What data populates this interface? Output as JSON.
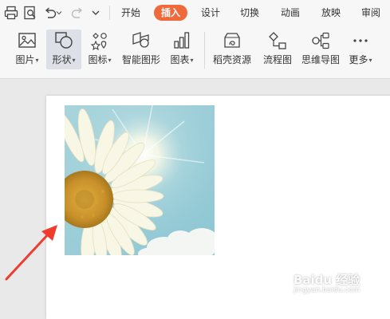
{
  "tabs": [
    {
      "label": "开始",
      "active": false
    },
    {
      "label": "插入",
      "active": true
    },
    {
      "label": "设计",
      "active": false
    },
    {
      "label": "切换",
      "active": false
    },
    {
      "label": "动画",
      "active": false
    },
    {
      "label": "放映",
      "active": false
    },
    {
      "label": "审阅",
      "active": false
    }
  ],
  "ribbon": [
    {
      "label": "图片",
      "has_dropdown": true,
      "icon": "picture-icon"
    },
    {
      "label": "形状",
      "has_dropdown": true,
      "icon": "shapes-icon",
      "selected": true
    },
    {
      "label": "图标",
      "has_dropdown": true,
      "icon": "icons-icon"
    },
    {
      "label": "智能图形",
      "has_dropdown": false,
      "icon": "smartart-icon"
    },
    {
      "label": "图表",
      "has_dropdown": true,
      "icon": "chart-icon"
    },
    {
      "label": "稻壳资源",
      "has_dropdown": false,
      "icon": "docer-resource-icon"
    },
    {
      "label": "流程图",
      "has_dropdown": false,
      "icon": "flowchart-icon"
    },
    {
      "label": "思维导图",
      "has_dropdown": false,
      "icon": "mindmap-icon"
    },
    {
      "label": "更多",
      "has_dropdown": true,
      "icon": "more-icon"
    }
  ],
  "caret": "▾",
  "watermark": {
    "text": "Baidu 经验",
    "sub": "jingyan.baidu.com"
  },
  "colors": {
    "accent": "#f0693a",
    "arrow": "#f03c2e",
    "selected_bg": "#dde0e6"
  }
}
